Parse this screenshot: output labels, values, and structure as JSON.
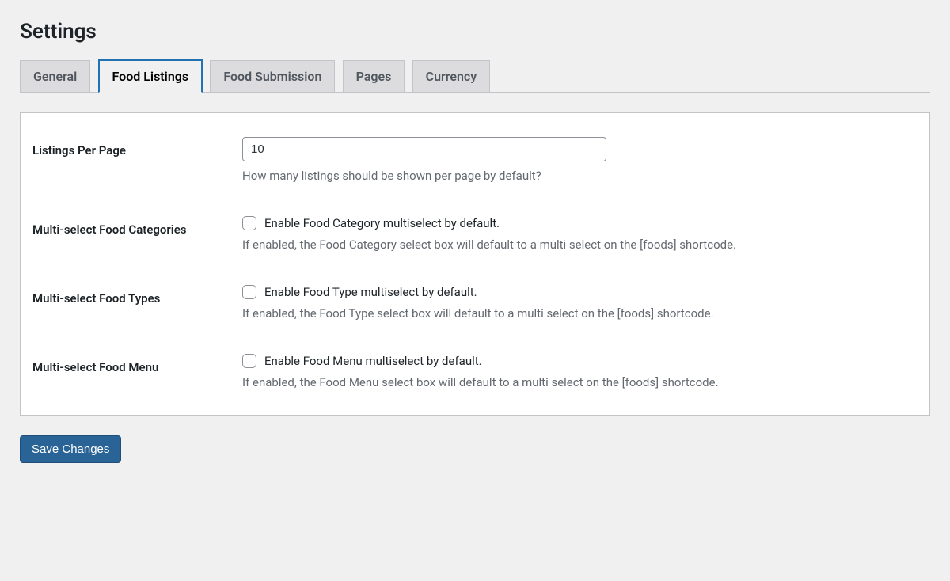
{
  "page": {
    "title": "Settings"
  },
  "tabs": [
    {
      "label": "General",
      "active": false
    },
    {
      "label": "Food Listings",
      "active": true
    },
    {
      "label": "Food Submission",
      "active": false
    },
    {
      "label": "Pages",
      "active": false
    },
    {
      "label": "Currency",
      "active": false
    }
  ],
  "form": {
    "listings_per_page": {
      "label": "Listings Per Page",
      "value": "10",
      "description": "How many listings should be shown per page by default?"
    },
    "multi_select_categories": {
      "label": "Multi-select Food Categories",
      "checkbox_label": "Enable Food Category multiselect by default.",
      "description": "If enabled, the Food Category select box will default to a multi select on the [foods] shortcode.",
      "checked": false
    },
    "multi_select_types": {
      "label": "Multi-select Food Types",
      "checkbox_label": "Enable Food Type multiselect by default.",
      "description": "If enabled, the Food Type select box will default to a multi select on the [foods] shortcode.",
      "checked": false
    },
    "multi_select_menu": {
      "label": "Multi-select Food Menu",
      "checkbox_label": "Enable Food Menu multiselect by default.",
      "description": "If enabled, the Food Menu select box will default to a multi select on the [foods] shortcode.",
      "checked": false
    }
  },
  "buttons": {
    "save": "Save Changes"
  }
}
